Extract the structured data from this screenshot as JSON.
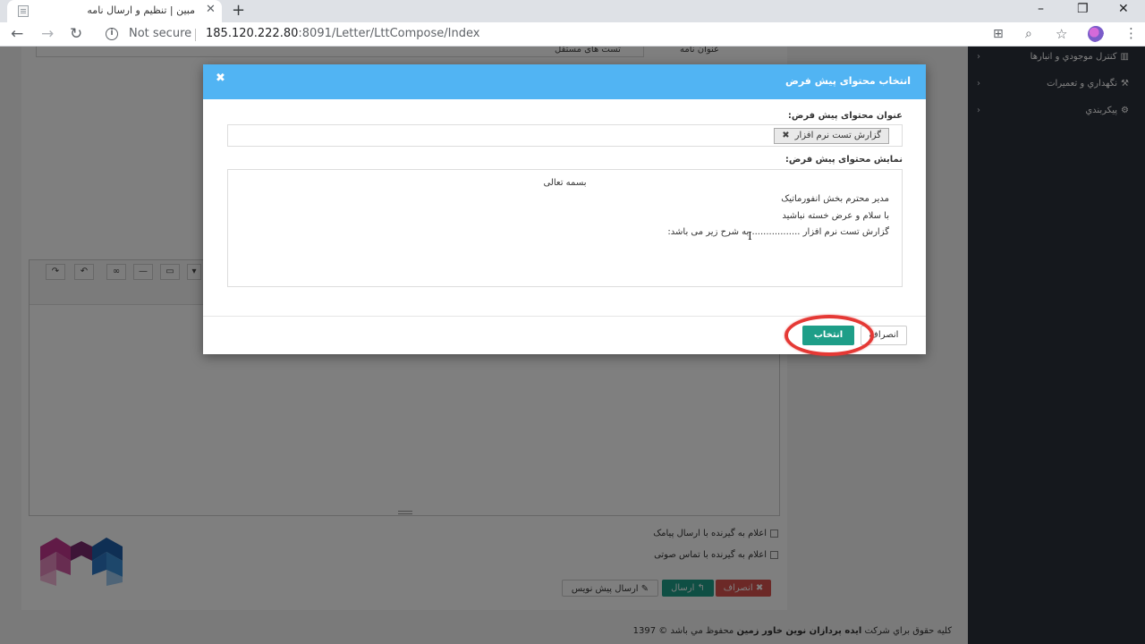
{
  "browser": {
    "tab_title": "مبین | تنظیم و ارسال نامه",
    "tab_close": "✕",
    "new_tab": "+",
    "not_secure": "Not secure",
    "url_host": "185.120.222.80",
    "url_rest": ":8091/Letter/LttCompose/Index",
    "window_controls": [
      "–",
      "❐",
      "✕"
    ],
    "icons": [
      "back-arrow-icon",
      "forward-arrow-icon",
      "reload-icon",
      "info-icon",
      "translate-icon",
      "zoom-icon",
      "star-icon",
      "extension-icon",
      "menu-dots-icon"
    ]
  },
  "sidebar": {
    "items": [
      {
        "label": "كنترل موجودي و انبارها",
        "icon": "inventory-icon"
      },
      {
        "label": "نگهداري و تعميرات",
        "icon": "wrench-icon"
      },
      {
        "label": "پيكربندي",
        "icon": "cogs-icon"
      }
    ]
  },
  "page": {
    "top_field_value": "تست های مستقل",
    "top_field_label": "عنوان نامه",
    "notify_sms": "اعلام به گیرنده با ارسال پیامک",
    "notify_call": "اعلام به گیرنده با تماس صوتی",
    "btn_draft": "✎ ارسال پیش نویس",
    "btn_send": "↰ ارسال",
    "btn_cancel": "✖ انصراف",
    "footer_prefix": "كليه حقوق براي شركت",
    "footer_company": "ايده پردازان نوين خاور زمين",
    "footer_suffix": "محفوظ مي باشد © 1397"
  },
  "modal": {
    "title": "انتخاب محتوای پیش فرض",
    "close": "✖",
    "field_title_label": "عنوان محتوای پیش فرض:",
    "selected_tag": "گزارش تست نرم افزار",
    "tag_remove": "✖",
    "field_preview_label": "نمایش محتوای پیش فرض:",
    "preview_lines": [
      "بسمه تعالی",
      "مدیر محترم بخش انفورماتیک",
      "با سلام و عرض خسته نباشید",
      "گزارش تست نرم افزار ................. به شرح زیر می باشد:"
    ],
    "btn_select": "انتخاب",
    "btn_cancel": "انصراف"
  },
  "colors": {
    "modal_header": "#51b4f3",
    "primary_green": "#1e9e88",
    "danger_red": "#d9534f",
    "sidebar_bg": "#2b303b",
    "highlight": "#e53935"
  }
}
